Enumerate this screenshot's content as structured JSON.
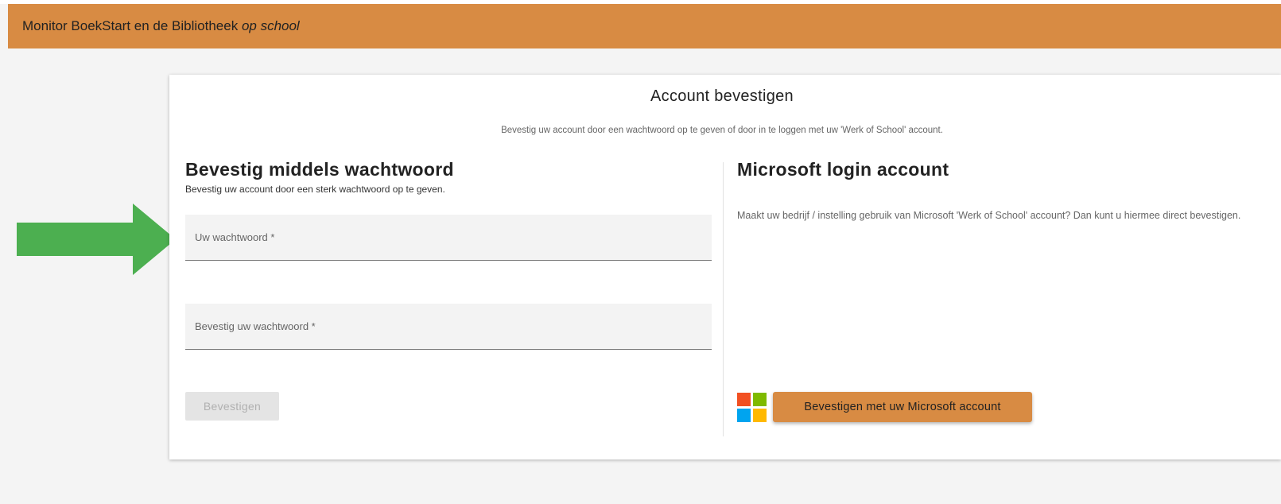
{
  "header": {
    "title_prefix": "Monitor BoekStart en de Bibliotheek ",
    "title_emphasis": "op school"
  },
  "card": {
    "title": "Account bevestigen",
    "subtitle": "Bevestig uw account door een wachtwoord op te geven of door in te loggen met uw 'Werk of School' account."
  },
  "password_section": {
    "title": "Bevestig middels wachtwoord",
    "description": "Bevestig uw account door een sterk wachtwoord op te geven.",
    "password_placeholder": "Uw wachtwoord *",
    "password_value": "",
    "confirm_placeholder": "Bevestig uw wachtwoord *",
    "confirm_value": "",
    "submit_label": "Bevestigen"
  },
  "microsoft_section": {
    "title": "Microsoft login account",
    "description": "Maakt uw bedrijf / instelling gebruik van Microsoft 'Werk of School' account? Dan kunt u hiermee direct bevestigen.",
    "logo_icon": "microsoft-logo-icon",
    "button_label": "Bevestigen met uw Microsoft account"
  },
  "annotation": {
    "icon": "arrow-right-icon"
  },
  "colors": {
    "brand_orange": "#d88b43",
    "arrow_green": "#4caf50",
    "background": "#f4f4f4"
  }
}
